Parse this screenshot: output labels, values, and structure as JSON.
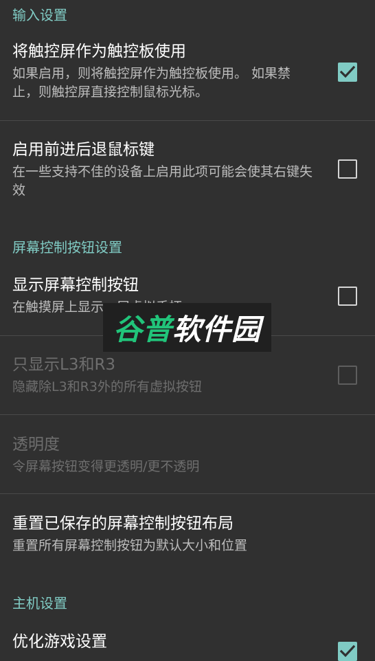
{
  "categories": {
    "input": "输入设置",
    "onscreen": "屏幕控制按钮设置",
    "host": "主机设置"
  },
  "prefs": {
    "touchpad": {
      "title": "将触控屏作为触控板使用",
      "summary": "如果启用，则将触控屏作为触控板使用。 如果禁止，则触控屏直接控制鼠标光标。",
      "checked": true
    },
    "mouse_nav": {
      "title": "启用前进后退鼠标键",
      "summary": "在一些支持不佳的设备上启用此项可能会使其右键失效",
      "checked": false
    },
    "show_osc": {
      "title": "显示屏幕控制按钮",
      "summary": "在触摸屏上显示一层虚拟手柄",
      "checked": false
    },
    "only_l3r3": {
      "title": "只显示L3和R3",
      "summary": "隐藏除L3和R3外的所有虚拟按钮",
      "checked": false,
      "enabled": false
    },
    "opacity": {
      "title": "透明度",
      "summary": "令屏幕按钮变得更透明/更不透明",
      "enabled": false
    },
    "reset_osc": {
      "title": "重置已保存的屏幕控制按钮布局",
      "summary": "重置所有屏幕控制按钮为默认大小和位置"
    },
    "optimize_games": {
      "title": "优化游戏设置",
      "checked": true
    }
  },
  "watermark": {
    "part1": "谷普",
    "part2": "软件园"
  },
  "colors": {
    "background": "#303030",
    "accent": "#80cbc4",
    "divider": "#4a4a4a"
  }
}
